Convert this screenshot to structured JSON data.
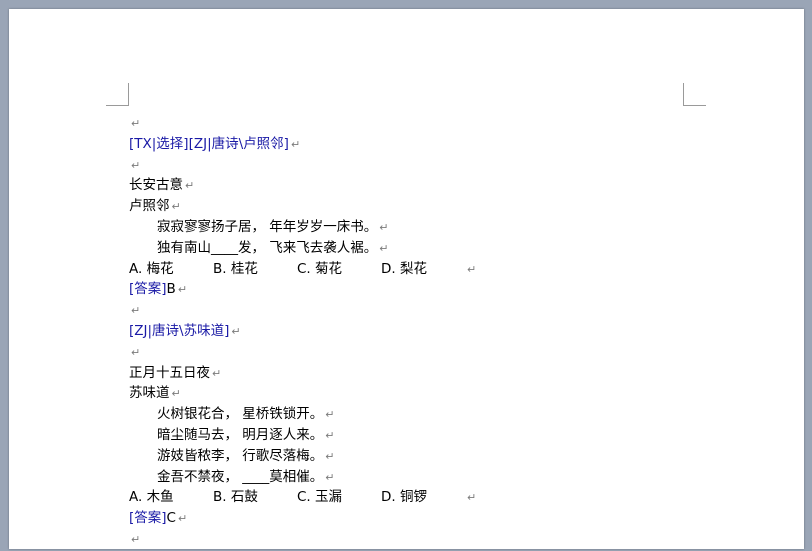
{
  "para_mark": "↵",
  "q1": {
    "tag": "[TX|选择][ZJ|唐诗\\卢照邻]",
    "title": "长安古意",
    "author": "卢照邻",
    "lines": [
      "寂寂寥寥扬子居， 年年岁岁一床书。",
      "独有南山____发， 飞来飞去袭人裾。"
    ],
    "options": [
      "A. 梅花",
      "B. 桂花",
      "C. 菊花",
      "D. 梨花"
    ],
    "answer_tag": "[答案]",
    "answer": "B"
  },
  "q2": {
    "tag": "[ZJ|唐诗\\苏味道]",
    "title": "正月十五日夜",
    "author": "苏味道",
    "lines": [
      "火树银花合， 星桥铁锁开。",
      "暗尘随马去， 明月逐人来。",
      "游妓皆秾李， 行歌尽落梅。",
      "金吾不禁夜， ____莫相催。"
    ],
    "options": [
      "A. 木鱼",
      "B. 石鼓",
      "C. 玉漏",
      "D. 铜锣"
    ],
    "answer_tag": "[答案]",
    "answer": "C"
  }
}
